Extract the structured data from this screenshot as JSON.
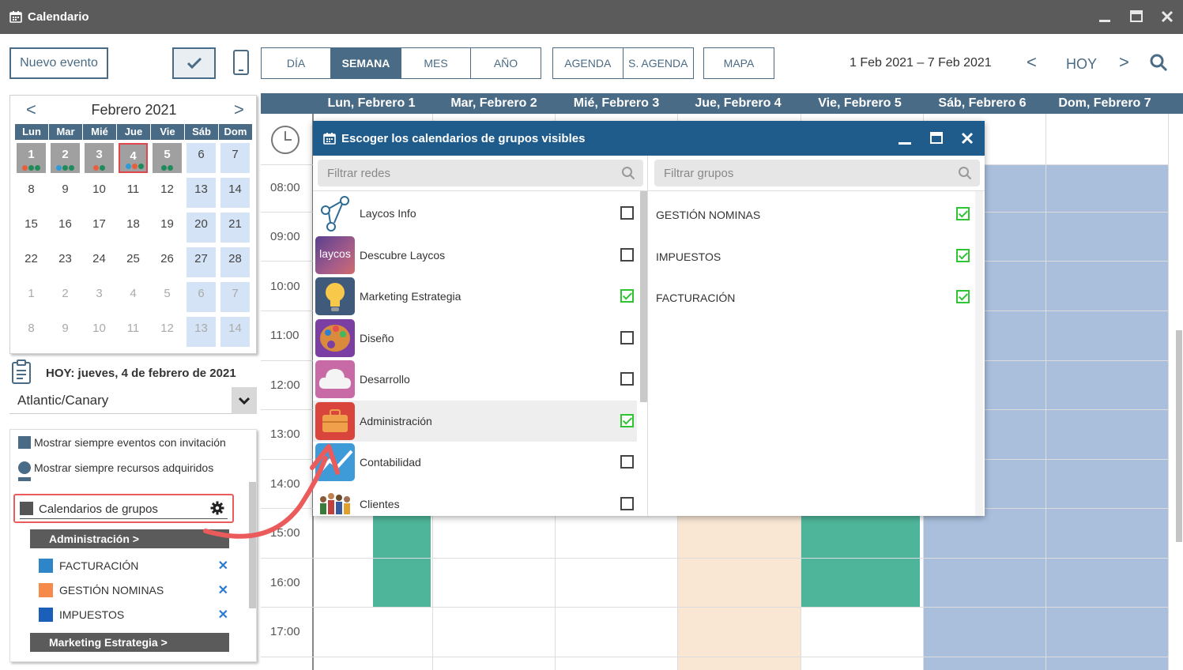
{
  "window": {
    "title": "Calendario"
  },
  "toolbar": {
    "new_event": "Nuevo evento",
    "views": [
      "DÍA",
      "SEMANA",
      "MES",
      "AÑO"
    ],
    "agenda": [
      "AGENDA",
      "S. AGENDA"
    ],
    "map": "MAPA",
    "date_range": "1 Feb 2021 – 7 Feb 2021",
    "prev": "<",
    "today": "HOY",
    "next": ">"
  },
  "minical": {
    "prev": "<",
    "title": "Febrero 2021",
    "next": ">",
    "weekdays": [
      "Lun",
      "Mar",
      "Mié",
      "Jue",
      "Vie",
      "Sáb",
      "Dom"
    ],
    "rows": [
      [
        "1",
        "2",
        "3",
        "4",
        "5",
        "6",
        "7"
      ],
      [
        "8",
        "9",
        "10",
        "11",
        "12",
        "13",
        "14"
      ],
      [
        "15",
        "16",
        "17",
        "18",
        "19",
        "20",
        "21"
      ],
      [
        "22",
        "23",
        "24",
        "25",
        "26",
        "27",
        "28"
      ],
      [
        "1",
        "2",
        "3",
        "4",
        "5",
        "6",
        "7"
      ],
      [
        "8",
        "9",
        "10",
        "11",
        "12",
        "13",
        "14"
      ]
    ]
  },
  "today_label": "HOY: jueves, 4 de febrero de 2021",
  "timezone": "Atlantic/Canary",
  "options": {
    "show_invites": "Mostrar siempre eventos con invitación",
    "show_resources": "Mostrar siempre recursos adquiridos",
    "group_calendars": "Calendarios de grupos",
    "groups": [
      {
        "name": "Administración >",
        "items": [
          {
            "label": "FACTURACIÓN",
            "color": "#2e86c8"
          },
          {
            "label": "GESTIÓN NOMINAS",
            "color": "#f58a4a"
          },
          {
            "label": "IMPUESTOS",
            "color": "#1a5fb8"
          }
        ]
      },
      {
        "name": "Marketing Estrategia >",
        "items": []
      }
    ],
    "remove": "✕"
  },
  "week": {
    "days": [
      "Lun, Febrero 1",
      "Mar, Febrero 2",
      "Mié, Febrero 3",
      "Jue, Febrero 4",
      "Vie, Febrero 5",
      "Sáb, Febrero 6",
      "Dom, Febrero 7"
    ],
    "hours": [
      "08:00",
      "09:00",
      "10:00",
      "11:00",
      "12:00",
      "13:00",
      "14:00",
      "15:00",
      "16:00",
      "17:00"
    ]
  },
  "dialog": {
    "title": "Escoger los calendarios de grupos visibles",
    "filter_networks": "Filtrar redes",
    "filter_groups": "Filtrar grupos",
    "networks": [
      {
        "name": "Laycos Info",
        "checked": false
      },
      {
        "name": "Descubre Laycos",
        "checked": false
      },
      {
        "name": "Marketing Estrategia",
        "checked": true
      },
      {
        "name": "Diseño",
        "checked": false
      },
      {
        "name": "Desarrollo",
        "checked": false
      },
      {
        "name": "Administración",
        "checked": true
      },
      {
        "name": "Contabilidad",
        "checked": false
      },
      {
        "name": "Clientes",
        "checked": false
      }
    ],
    "groups": [
      {
        "name": "GESTIÓN NOMINAS",
        "checked": true
      },
      {
        "name": "IMPUESTOS",
        "checked": true
      },
      {
        "name": "FACTURACIÓN",
        "checked": true
      }
    ],
    "logo_text": "laycos"
  },
  "colors": {
    "accent": "#4a6b85",
    "dialog_header": "#1f5c8b",
    "event_green": "#4fb59a",
    "event_peach": "#f9e7d4",
    "weekend_blue": "#a9bfdc",
    "highlight_red": "#ec5b5b"
  }
}
